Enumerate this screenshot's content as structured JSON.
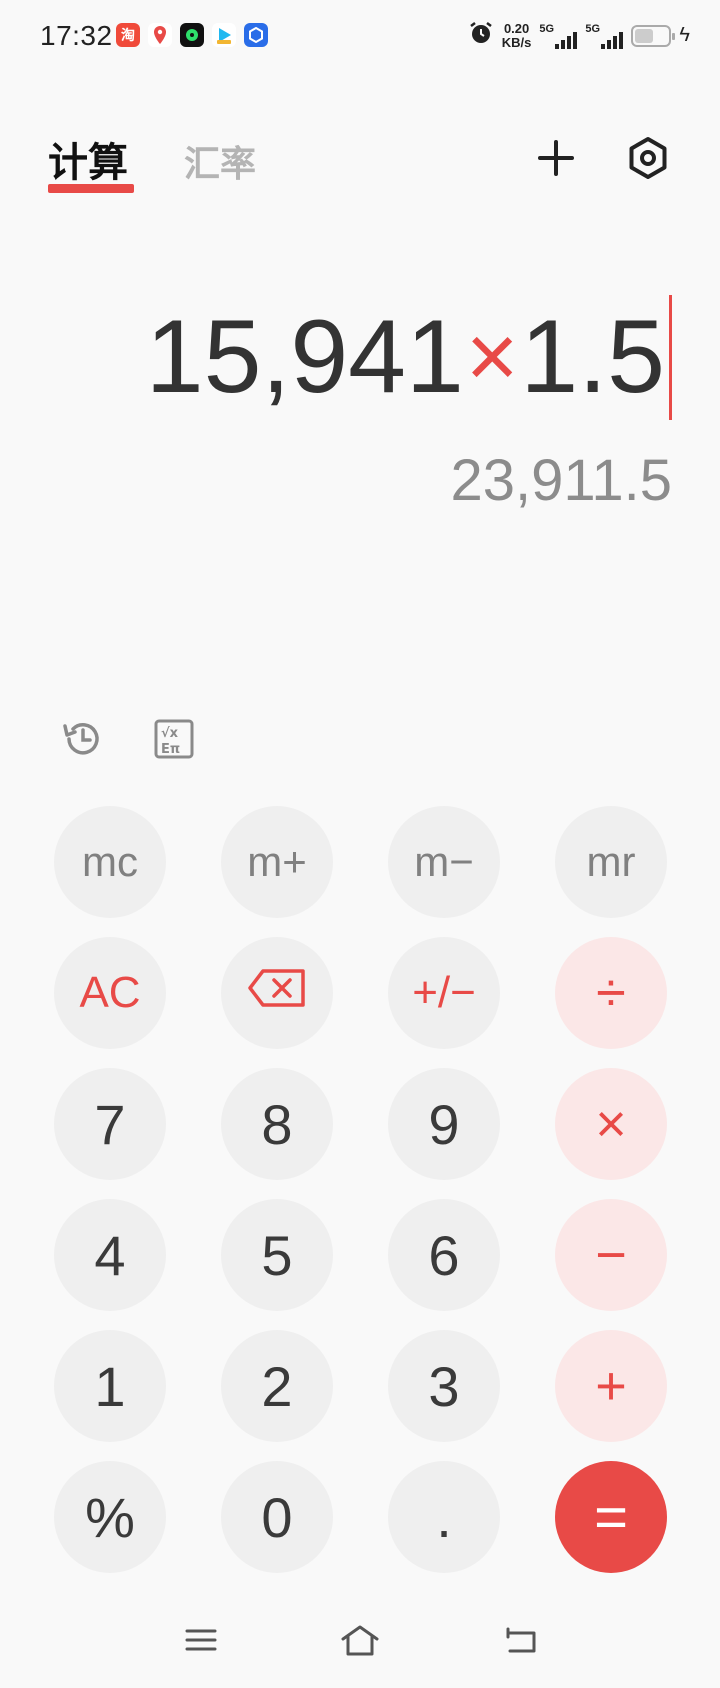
{
  "status_bar": {
    "time": "17:32",
    "net_speed_value": "0.20",
    "net_speed_unit": "KB/s",
    "sim1": "5G",
    "sim2": "5G",
    "battery_level": 0.55,
    "app_icons": [
      "taobao-icon",
      "map-pin-icon",
      "music-icon",
      "video-play-icon",
      "box-app-icon"
    ]
  },
  "header": {
    "tabs": [
      {
        "label": "计算",
        "active": true
      },
      {
        "label": "汇率",
        "active": false
      }
    ],
    "collapse_icon": "collapse-icon",
    "settings_icon": "settings-icon"
  },
  "display": {
    "operand1": "15,941",
    "operator": "×",
    "operand2": "1.5",
    "result": "23,911.5"
  },
  "tools": {
    "history_icon": "history-icon",
    "scientific_icon": "scientific-mode-icon"
  },
  "keypad": {
    "memory": [
      "mc",
      "m+",
      "m−",
      "mr"
    ],
    "row_fn": [
      "AC",
      "⌫",
      "+/−",
      "÷"
    ],
    "row7": [
      "7",
      "8",
      "9",
      "×"
    ],
    "row4": [
      "4",
      "5",
      "6",
      "−"
    ],
    "row1": [
      "1",
      "2",
      "3",
      "+"
    ],
    "row0": [
      "%",
      "0",
      ".",
      "="
    ]
  },
  "nav_bar": [
    "menu-icon",
    "home-icon",
    "back-icon"
  ],
  "colors": {
    "accent": "#e84a47",
    "accent_light": "#fbe7e7",
    "key_bg": "#efefef",
    "background": "#f9f9f9"
  }
}
